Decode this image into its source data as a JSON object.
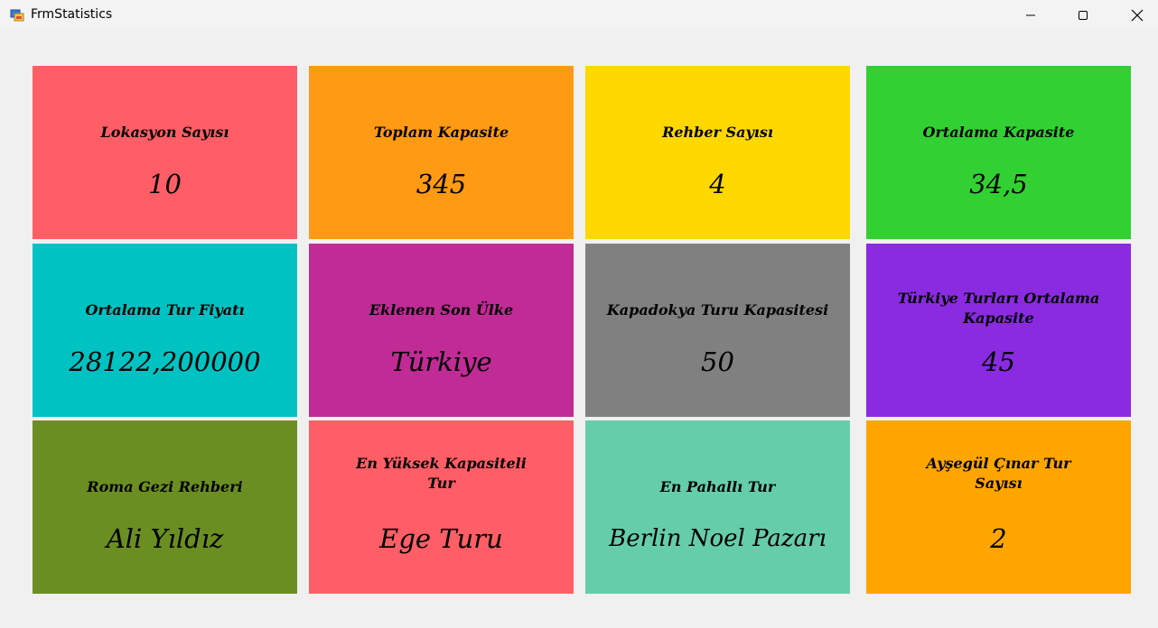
{
  "window": {
    "title": "FrmStatistics",
    "icon": "winforms-app-icon",
    "controls": [
      "minimize-icon",
      "maximize-icon",
      "close-icon"
    ]
  },
  "cards": [
    {
      "label": "Lokasyon Sayısı",
      "value": "10",
      "color": "#ff5e66"
    },
    {
      "label": "Toplam Kapasite",
      "value": "345",
      "color": "#ff9a14"
    },
    {
      "label": "Rehber Sayısı",
      "value": "4",
      "color": "#ffd800"
    },
    {
      "label": "Ortalama Kapasite",
      "value": "34,5",
      "color": "#33d033"
    },
    {
      "label": "Ortalama Tur Fiyatı",
      "value": "28122,200000",
      "color": "#00c2c2"
    },
    {
      "label": "Eklenen Son Ülke",
      "value": "Türkiye",
      "color": "#c02b96"
    },
    {
      "label": "Kapadokya Turu Kapasitesi",
      "value": "50",
      "color": "#808080"
    },
    {
      "label": "Türkiye Turları Ortalama Kapasite",
      "value": "45",
      "color": "#8a2be2"
    },
    {
      "label": "Roma Gezi Rehberi",
      "value": "Ali Yıldız",
      "color": "#6b8e23"
    },
    {
      "label": "En Yüksek Kapasiteli Tur",
      "value": "Ege Turu",
      "color": "#ff5e66"
    },
    {
      "label": "En Pahallı Tur",
      "value": "Berlin Noel Pazarı",
      "color": "#66cdaa"
    },
    {
      "label": "Ayşegül Çınar Tur Sayısı",
      "value": "2",
      "color": "#ffa500"
    }
  ]
}
